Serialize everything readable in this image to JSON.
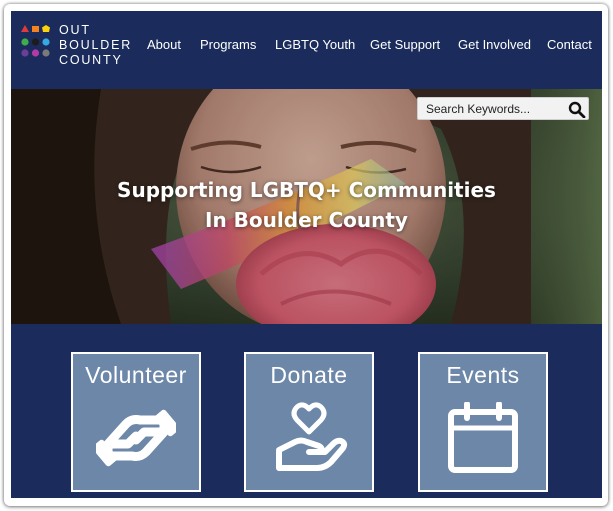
{
  "brand": {
    "line1": "OUT",
    "line2": "BOULDER",
    "line3": "COUNTY",
    "dot_colors": [
      "#e03a3e",
      "#f5821f",
      "#fbd20b",
      "#3fae49",
      "#1c1c1c",
      "#36a9e1",
      "#6a3f98",
      "#b23aa8",
      "#7a7a7a"
    ]
  },
  "nav": {
    "items": [
      "About",
      "Programs",
      "LGBTQ Youth",
      "Get Support",
      "Get Involved",
      "Contact"
    ]
  },
  "search": {
    "placeholder": "Search Keywords..."
  },
  "hero": {
    "title_line1": "Supporting LGBTQ+ Communities",
    "title_line2": "In Boulder County"
  },
  "cards": {
    "volunteer": {
      "label": "Volunteer",
      "icon": "handshake-icon"
    },
    "donate": {
      "label": "Donate",
      "icon": "heart-in-hand-icon"
    },
    "events": {
      "label": "Events",
      "icon": "calendar-icon"
    }
  },
  "colors": {
    "navy": "#1b2c5c",
    "card": "#6d87a9",
    "white": "#ffffff"
  }
}
